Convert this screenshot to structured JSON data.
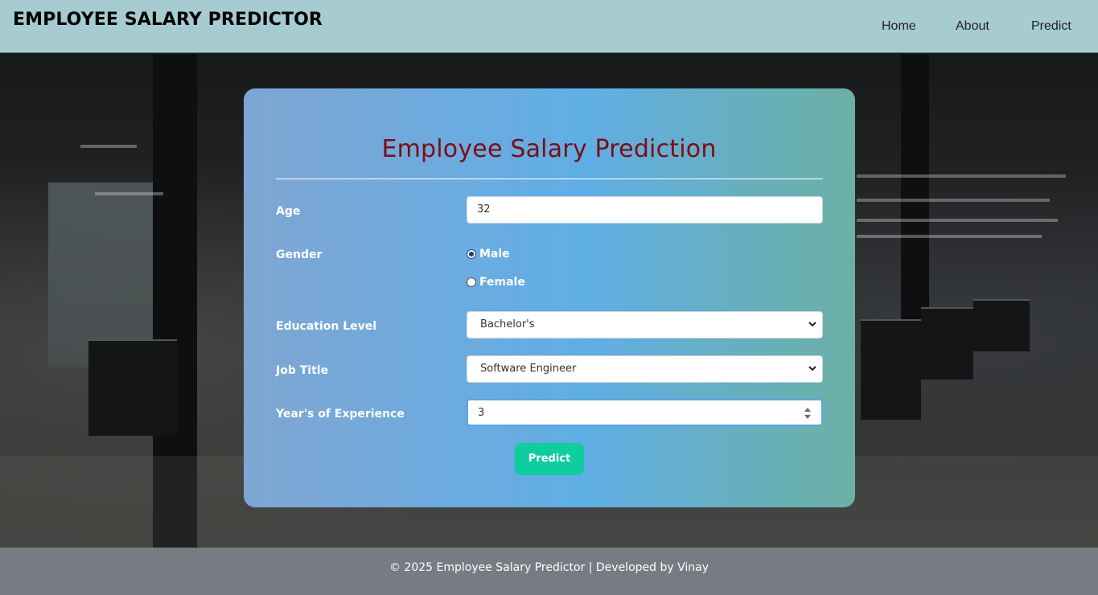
{
  "header": {
    "brand": "EMPLOYEE SALARY PREDICTOR",
    "nav": [
      {
        "label": "Home"
      },
      {
        "label": "About"
      },
      {
        "label": "Predict"
      }
    ]
  },
  "form": {
    "title": "Employee Salary Prediction",
    "age": {
      "label": "Age",
      "value": "32"
    },
    "gender": {
      "label": "Gender",
      "options": [
        {
          "label": "Male",
          "selected": true
        },
        {
          "label": "Female",
          "selected": false
        }
      ]
    },
    "education": {
      "label": "Education Level",
      "value": "Bachelor's"
    },
    "job_title": {
      "label": "Job Title",
      "value": "Software Engineer"
    },
    "experience": {
      "label": "Year's of Experience",
      "value": "3"
    },
    "submit_label": "Predict"
  },
  "footer": {
    "text": "© 2025 Employee Salary Predictor | Developed by Vinay"
  },
  "colors": {
    "header_bg": "#a6ccd2",
    "title": "#7c0d14",
    "button": "#0fcd9d",
    "footer_bg": "#777b82"
  },
  "icons": {
    "select_caret": "chevron-down-icon",
    "number_spinner": "spinner-arrows-icon"
  }
}
